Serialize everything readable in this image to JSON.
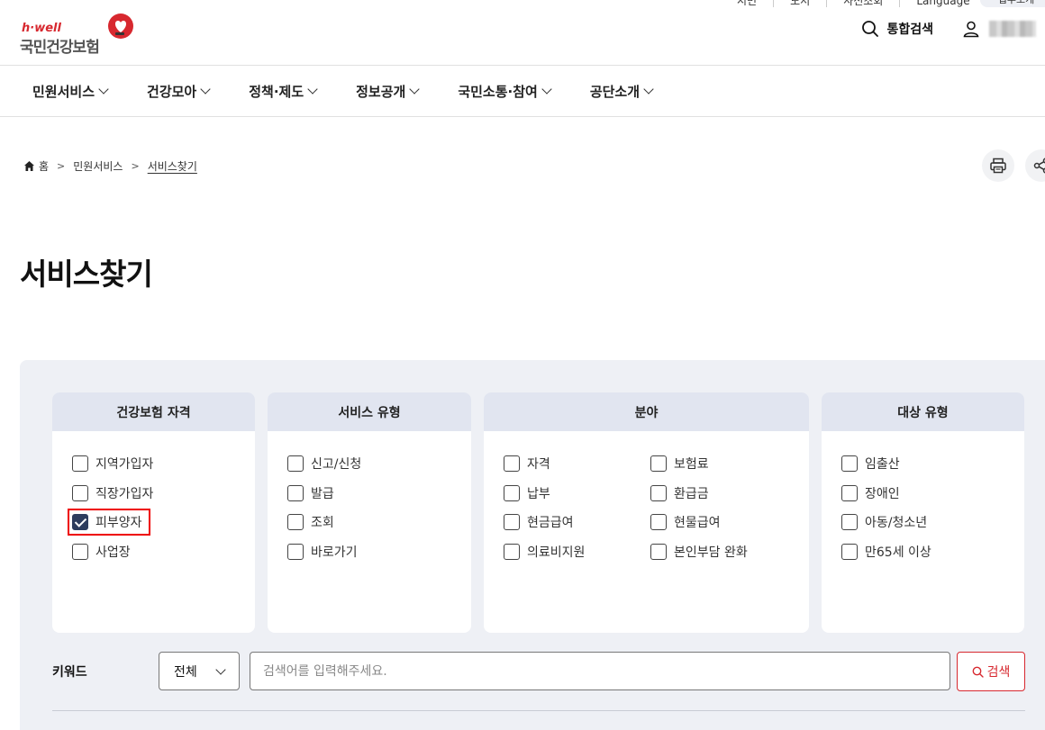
{
  "utility": {
    "items": [
      "시민",
      "도서",
      "사전조회",
      "Language"
    ],
    "pill": "업무소개"
  },
  "logo": {
    "brand_en": "h·well",
    "brand_ko": "국민건강보험"
  },
  "header": {
    "search_label": "통합검색"
  },
  "gnb": {
    "items": [
      "민원서비스",
      "건강모아",
      "정책·제도",
      "정보공개",
      "국민소통·참여",
      "공단소개"
    ]
  },
  "breadcrumb": {
    "home": "홈",
    "level1": "민원서비스",
    "current": "서비스찾기"
  },
  "page_title": "서비스찾기",
  "filters": {
    "qualification": {
      "title": "건강보험 자격",
      "options": [
        {
          "label": "지역가입자",
          "checked": false
        },
        {
          "label": "직장가입자",
          "checked": false
        },
        {
          "label": "피부양자",
          "checked": true
        },
        {
          "label": "사업장",
          "checked": false
        }
      ]
    },
    "service_type": {
      "title": "서비스 유형",
      "options": [
        {
          "label": "신고/신청",
          "checked": false
        },
        {
          "label": "발급",
          "checked": false
        },
        {
          "label": "조회",
          "checked": false
        },
        {
          "label": "바로가기",
          "checked": false
        }
      ]
    },
    "field": {
      "title": "분야",
      "options": [
        {
          "label": "자격",
          "checked": false
        },
        {
          "label": "보험료",
          "checked": false
        },
        {
          "label": "납부",
          "checked": false
        },
        {
          "label": "환급금",
          "checked": false
        },
        {
          "label": "현금급여",
          "checked": false
        },
        {
          "label": "현물급여",
          "checked": false
        },
        {
          "label": "의료비지원",
          "checked": false
        },
        {
          "label": "본인부담 완화",
          "checked": false
        }
      ]
    },
    "target_type": {
      "title": "대상 유형",
      "options": [
        {
          "label": "임출산",
          "checked": false
        },
        {
          "label": "장애인",
          "checked": false
        },
        {
          "label": "아동/청소년",
          "checked": false
        },
        {
          "label": "만65세 이상",
          "checked": false
        }
      ]
    }
  },
  "keyword": {
    "label": "키워드",
    "select_value": "전체",
    "placeholder": "검색어를 입력해주세요.",
    "button": "검색"
  },
  "colors": {
    "accent": "#d7282f",
    "panel_bg": "#eef0f5",
    "card_head_bg": "#e1e5f0",
    "checked_bg": "#2d3d5e",
    "highlight": "#ee0000"
  }
}
